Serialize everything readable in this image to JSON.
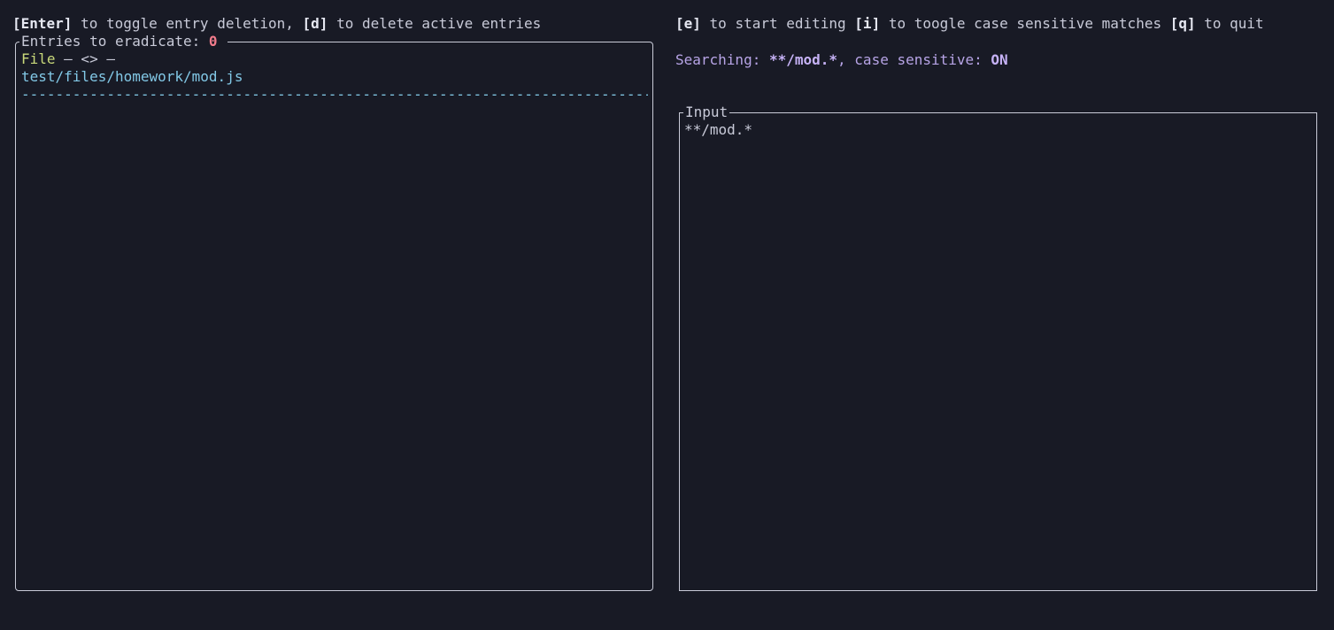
{
  "help_left": {
    "key_enter": "[Enter]",
    "text_enter": " to toggle entry deletion, ",
    "key_d": "[d]",
    "text_d": " to delete active entries"
  },
  "help_right": {
    "key_e": "[e]",
    "text_e": " to start editing ",
    "key_i": "[i]",
    "text_i": " to toogle case sensitive matches ",
    "key_q": "[q]",
    "text_q": " to quit"
  },
  "search_status": {
    "prefix": "Searching: ",
    "pattern": "**/mod.*",
    "middle": ", case sensitive: ",
    "case_sensitive": "ON"
  },
  "entries_panel": {
    "title": "Entries to eradicate: ",
    "count": "0",
    "entries": [
      {
        "type": "File",
        "meta": " – <> –",
        "path": "test/files/homework/mod.js",
        "divider": "--------------------------------------------------------------------------------------------------"
      }
    ]
  },
  "input_panel": {
    "title": "Input",
    "value": "**/mod.*"
  },
  "colors": {
    "background": "#181a25",
    "count": "#f27c8c",
    "file_type": "#c9d97a",
    "path": "#82c8e6",
    "search": "#b7a4e6"
  }
}
